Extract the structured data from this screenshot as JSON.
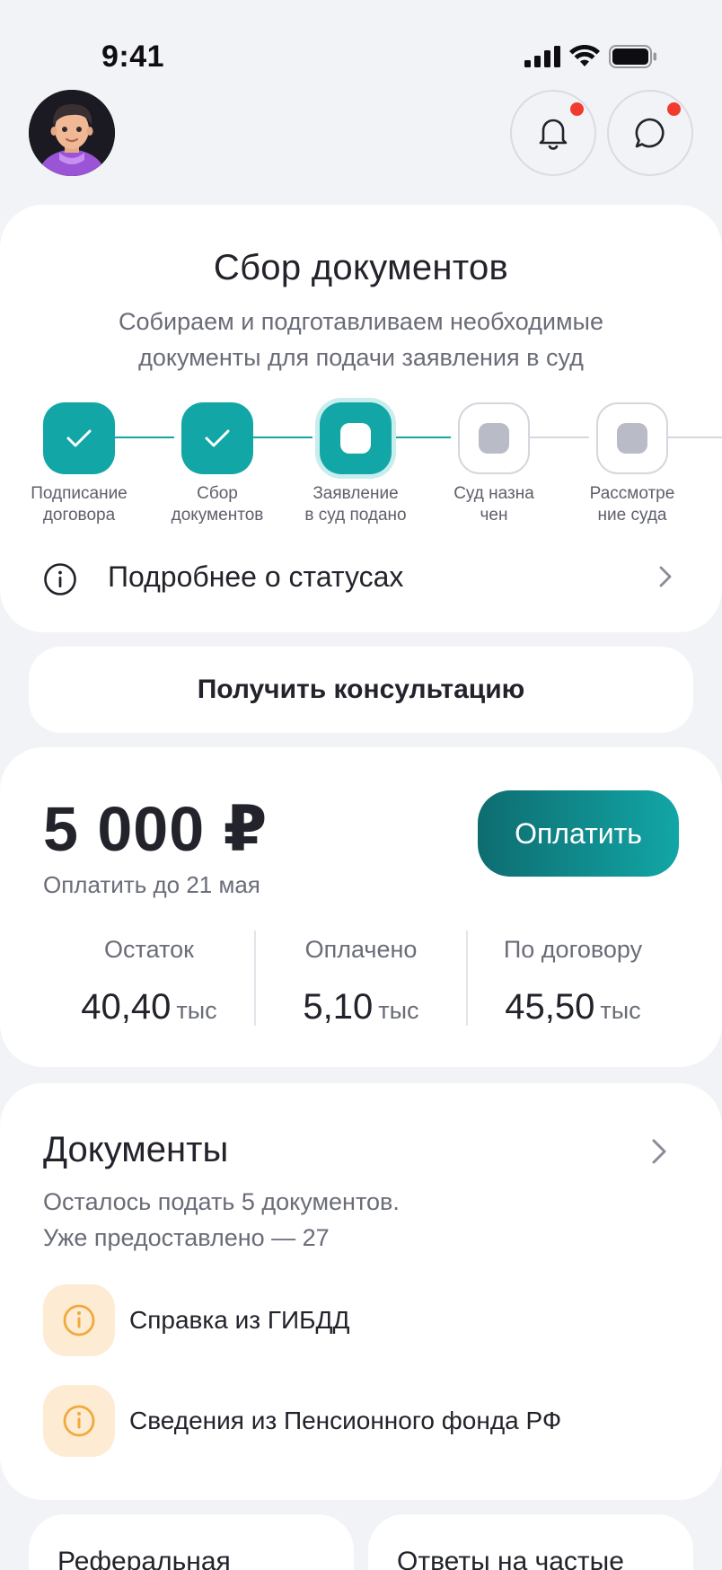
{
  "status_bar": {
    "time": "9:41"
  },
  "header": {
    "avatar": "avatar",
    "notifications_icon": "bell-icon",
    "chat_icon": "chat-bubble-icon"
  },
  "case_status": {
    "title": "Сбор документов",
    "subtitle_line1": "Собираем и подготавливаем необходимые",
    "subtitle_line2": "документы для подачи заявления в суд",
    "steps": [
      {
        "line1": "Подписание",
        "line2": "договора",
        "state": "done"
      },
      {
        "line1": "Сбор",
        "line2": "документов",
        "state": "done"
      },
      {
        "line1": "Заявление",
        "line2": "в суд подано",
        "state": "current"
      },
      {
        "line1": "Суд назна",
        "line2": "чен",
        "state": "pending"
      },
      {
        "line1": "Рассмотре",
        "line2": "ние суда",
        "state": "pending"
      }
    ],
    "more_link": "Подробнее о статусах"
  },
  "consult_button": "Получить консультацию",
  "payment": {
    "amount": "5 000 ₽",
    "due": "Оплатить до 21 мая",
    "pay_button": "Оплатить",
    "stats": [
      {
        "label": "Остаток",
        "value": "40,40",
        "unit": "тыс"
      },
      {
        "label": "Оплачено",
        "value": "5,10",
        "unit": "тыс"
      },
      {
        "label": "По договору",
        "value": "45,50",
        "unit": "тыс"
      }
    ]
  },
  "documents": {
    "title": "Документы",
    "subtitle_line1": "Осталось подать 5 документов.",
    "subtitle_line2": "Уже предоставлено — 27",
    "items": [
      {
        "label": "Справка из ГИБДД",
        "icon": "info-warning-icon"
      },
      {
        "label": "Сведения из Пенсионного фонда РФ",
        "icon": "info-warning-icon"
      }
    ]
  },
  "tiles": [
    {
      "label": "Реферальная"
    },
    {
      "label": "Ответы на частые"
    }
  ],
  "colors": {
    "accent": "#12A6A6",
    "accent_dark": "#0E6C70",
    "badge": "#F23B2F",
    "warning_bg": "#FDEBD3",
    "warning": "#F2A93B"
  }
}
